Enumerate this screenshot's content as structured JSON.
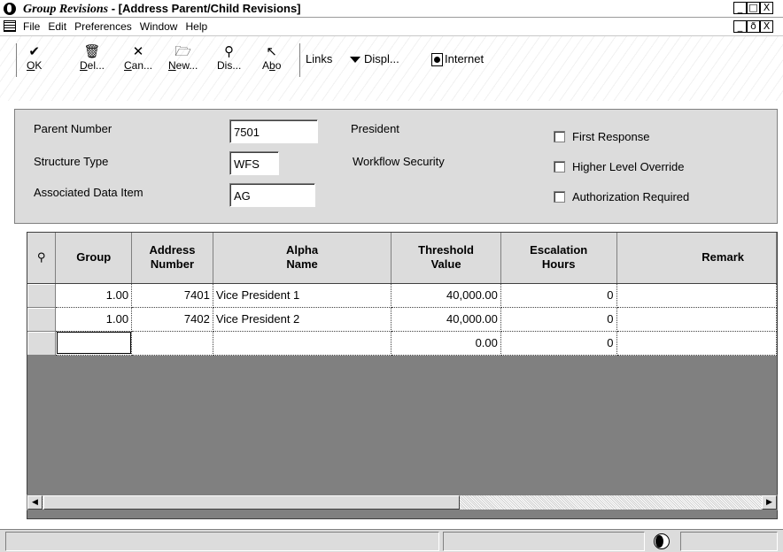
{
  "window": {
    "app_name": "Group Revisions",
    "doc_title": " - [Address Parent/Child Revisions]",
    "controls": [
      "_",
      "□",
      "X"
    ],
    "doc_controls": [
      "_",
      "ð",
      "X"
    ]
  },
  "menu": [
    {
      "key": "F",
      "rest": "ile"
    },
    {
      "key": "E",
      "rest": "dit"
    },
    {
      "key": "P",
      "rest": "references"
    },
    {
      "key": "W",
      "rest": "indow"
    },
    {
      "key": "H",
      "rest": "elp"
    }
  ],
  "toolbar": {
    "buttons": [
      {
        "icon": "✔",
        "pre": "",
        "key": "O",
        "post": "K"
      },
      {
        "icon": "🗑",
        "pre": "",
        "key": "D",
        "post": "el..."
      },
      {
        "icon": "✕",
        "pre": "",
        "key": "C",
        "post": "an..."
      },
      {
        "icon": "🗁",
        "pre": "",
        "key": "N",
        "post": "ew..."
      },
      {
        "icon": "⚲",
        "pre": "Dis...",
        "key": "",
        "post": ""
      },
      {
        "icon": "↖",
        "pre": "A",
        "key": "b",
        "post": "o"
      }
    ],
    "links_label": "Links",
    "display_label": "Displ...",
    "internet_label": "Internet"
  },
  "form": {
    "parent_number_label": "Parent Number",
    "parent_number_value": "7501",
    "parent_name": "President",
    "structure_type_label": "Structure Type",
    "structure_type_value": "WFS",
    "structure_type_desc": "Workflow Security",
    "associated_item_label": "Associated Data Item",
    "associated_item_value": "AG",
    "checkboxes": [
      "First Response",
      "Higher Level Override",
      "Authorization Required"
    ]
  },
  "grid": {
    "columns": [
      {
        "line1": "Group",
        "line2": ""
      },
      {
        "line1": "Address",
        "line2": "Number"
      },
      {
        "line1": "Alpha",
        "line2": "Name"
      },
      {
        "line1": "Threshold",
        "line2": "Value"
      },
      {
        "line1": "Escalation",
        "line2": "Hours"
      },
      {
        "line1": "Remark",
        "line2": ""
      }
    ],
    "rows": [
      {
        "group": "1.00",
        "address": "7401",
        "name": "Vice President 1",
        "threshold": "40,000.00",
        "hours": "0",
        "remark": ""
      },
      {
        "group": "1.00",
        "address": "7402",
        "name": "Vice President 2",
        "threshold": "40,000.00",
        "hours": "0",
        "remark": ""
      },
      {
        "group": "",
        "address": "",
        "name": "",
        "threshold": "0.00",
        "hours": "0",
        "remark": ""
      }
    ]
  }
}
